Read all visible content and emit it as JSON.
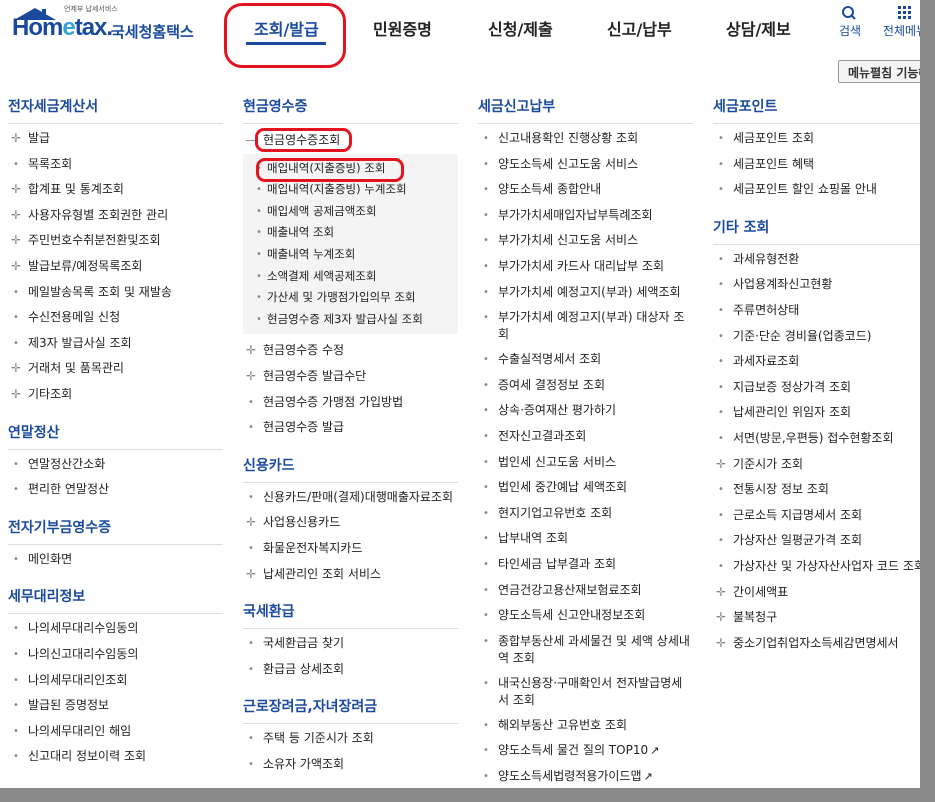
{
  "header": {
    "logo_tag": "언제부 납세서비스",
    "logo_word_a": "Hom",
    "logo_word_e": "e",
    "logo_word_b": "tax.",
    "logo_kr": "국세청홈택스",
    "nav": [
      "조회/발급",
      "민원증명",
      "신청/제출",
      "신고/납부",
      "상담/제보"
    ],
    "search_label": "검색",
    "allmenu_label": "전체메뉴",
    "menu_fold_label": "메뉴펼침 기능해"
  },
  "columns": {
    "c1": {
      "sections": [
        {
          "title": "전자세금계산서",
          "items": [
            {
              "label": "발급",
              "marker": "+"
            },
            {
              "label": "목록조회",
              "marker": "·"
            },
            {
              "label": "합계표 및 통계조회",
              "marker": "+"
            },
            {
              "label": "사용자유형별 조회권한 관리",
              "marker": "+"
            },
            {
              "label": "주민번호수취분전환및조회",
              "marker": "+"
            },
            {
              "label": "발급보류/예정목록조회",
              "marker": "+"
            },
            {
              "label": "메일발송목록 조회 및 재발송",
              "marker": "·"
            },
            {
              "label": "수신전용메일 신청",
              "marker": "·"
            },
            {
              "label": "제3자 발급사실 조회",
              "marker": "·"
            },
            {
              "label": "거래처 및 품목관리",
              "marker": "+"
            },
            {
              "label": "기타조회",
              "marker": "+"
            }
          ]
        },
        {
          "title": "연말정산",
          "items": [
            {
              "label": "연말정산간소화",
              "marker": "·"
            },
            {
              "label": "편리한 연말정산",
              "marker": "·"
            }
          ]
        },
        {
          "title": "전자기부금영수증",
          "items": [
            {
              "label": "메인화면",
              "marker": "·"
            }
          ]
        },
        {
          "title": "세무대리정보",
          "items": [
            {
              "label": "나의세무대리수임동의",
              "marker": "·"
            },
            {
              "label": "나의신고대리수임동의",
              "marker": "·"
            },
            {
              "label": "나의세무대리인조회",
              "marker": "·"
            },
            {
              "label": "발급된 증명정보",
              "marker": "·"
            },
            {
              "label": "나의세무대리인 해임",
              "marker": "·"
            },
            {
              "label": "신고대리 정보이력 조회",
              "marker": "·"
            }
          ]
        }
      ]
    },
    "c2": {
      "cash_title": "현금영수증",
      "cash_open_label": "현금영수증조회",
      "cash_sub": [
        "매입내역(지출증빙) 조회",
        "매입내역(지출증빙) 누계조회",
        "매입세액 공제금액조회",
        "매출내역 조회",
        "매출내역 누계조회",
        "소액결제 세액공제조회",
        "가산세 및 가맹점가입의무 조회",
        "현금영수증 제3자 발급사실 조회"
      ],
      "cash_more": [
        {
          "label": "현금영수증 수정",
          "marker": "+"
        },
        {
          "label": "현금영수증 발급수단",
          "marker": "+"
        },
        {
          "label": "현금영수증 가맹점 가입방법",
          "marker": "·"
        },
        {
          "label": "현금영수증 발급",
          "marker": "·"
        }
      ],
      "sections": [
        {
          "title": "신용카드",
          "items": [
            {
              "label": "신용카드/판매(결제)대행매출자료조회",
              "marker": "·"
            },
            {
              "label": "사업용신용카드",
              "marker": "+"
            },
            {
              "label": "화물운전자복지카드",
              "marker": "·"
            },
            {
              "label": "납세관리인 조회 서비스",
              "marker": "+"
            }
          ]
        },
        {
          "title": "국세환급",
          "items": [
            {
              "label": "국세환급금 찾기",
              "marker": "·"
            },
            {
              "label": "환급금 상세조회",
              "marker": "·"
            }
          ]
        },
        {
          "title": "근로장려금,자녀장려금",
          "items": [
            {
              "label": "주택 등 기준시가 조회",
              "marker": "·"
            },
            {
              "label": "소유자 가액조회",
              "marker": "·"
            }
          ]
        }
      ]
    },
    "c3": {
      "title": "세금신고납부",
      "items": [
        {
          "label": "신고내용확인 진행상황 조회"
        },
        {
          "label": "양도소득세 신고도움 서비스"
        },
        {
          "label": "양도소득세 종합안내"
        },
        {
          "label": "부가가치세매입자납부특례조회"
        },
        {
          "label": "부가가치세 신고도움 서비스"
        },
        {
          "label": "부가가치세 카드사 대리납부 조회"
        },
        {
          "label": "부가가치세 예정고지(부과) 세액조회"
        },
        {
          "label": "부가가치세 예정고지(부과) 대상자 조",
          "label2": "회"
        },
        {
          "label": "수출실적명세서 조회"
        },
        {
          "label": "증여세 결정정보 조회"
        },
        {
          "label": "상속·증여재산 평가하기"
        },
        {
          "label": "전자신고결과조회"
        },
        {
          "label": "법인세 신고도움 서비스"
        },
        {
          "label": "법인세 중간예납 세액조회"
        },
        {
          "label": "현지기업고유번호 조회"
        },
        {
          "label": "납부내역 조회"
        },
        {
          "label": "타인세금 납부결과 조회"
        },
        {
          "label": "연금건강고용산재보험료조회"
        },
        {
          "label": "양도소득세 신고안내정보조회"
        },
        {
          "label": "종합부동산세 과세물건 및 세액 상세내",
          "label2": "역 조회"
        },
        {
          "label": "내국신용장·구매확인서 전자발급명세",
          "label2": "서 조회"
        },
        {
          "label": "해외부동산 고유번호 조회"
        },
        {
          "label": "양도소득세 물건 질의 TOP10",
          "ext": "↗"
        },
        {
          "label": "양도소득세법령적용가이드맵",
          "ext": "↗"
        }
      ]
    },
    "c4": {
      "sections": [
        {
          "title": "세금포인트",
          "items": [
            {
              "label": "세금포인트 조회",
              "marker": "·"
            },
            {
              "label": "세금포인트 혜택",
              "marker": "·"
            },
            {
              "label": "세금포인트 할인 쇼핑몰 안내",
              "marker": "·"
            }
          ]
        },
        {
          "title": "기타 조회",
          "items": [
            {
              "label": "과세유형전환",
              "marker": "·"
            },
            {
              "label": "사업용계좌신고현황",
              "marker": "·"
            },
            {
              "label": "주류면허상태",
              "marker": "·"
            },
            {
              "label": "기준·단순 경비율(업종코드)",
              "marker": "·"
            },
            {
              "label": "과세자료조회",
              "marker": "·"
            },
            {
              "label": "지급보증 정상가격 조회",
              "marker": "·"
            },
            {
              "label": "납세관리인 위임자 조회",
              "marker": "·"
            },
            {
              "label": "서면(방문,우편등) 접수현황조회",
              "marker": "·"
            },
            {
              "label": "기준시가 조회",
              "marker": "+"
            },
            {
              "label": "전통시장 정보 조회",
              "marker": "·"
            },
            {
              "label": "근로소득 지급명세서 조회",
              "marker": "·"
            },
            {
              "label": "가상자산 일평균가격 조회",
              "marker": "·"
            },
            {
              "label": "가상자산 및 가상자산사업자 코드 조회",
              "marker": "·"
            },
            {
              "label": "간이세액표",
              "marker": "+"
            },
            {
              "label": "불복청구",
              "marker": "+"
            },
            {
              "label": "중소기업취업자소득세감면명세서",
              "marker": "+"
            }
          ]
        }
      ]
    }
  }
}
